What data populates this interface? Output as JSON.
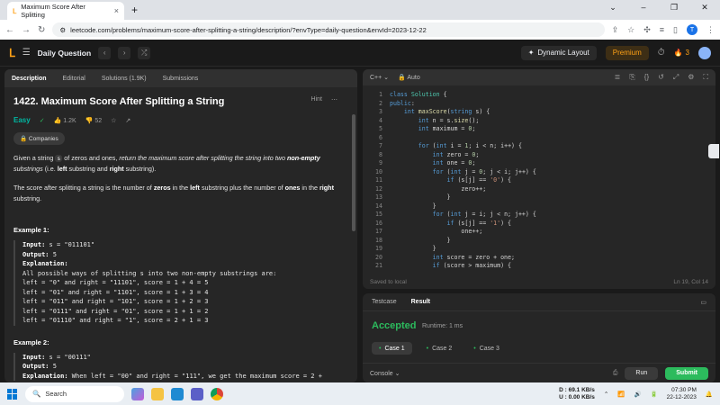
{
  "browser": {
    "tab_title": "Maximum Score After Splitting",
    "url": "leetcode.com/problems/maximum-score-after-splitting-a-string/description/?envType=daily-question&envId=2023-12-22"
  },
  "nav": {
    "title": "Daily Question",
    "dynamic_layout": "Dynamic Layout",
    "premium": "Premium",
    "streak": "3"
  },
  "left": {
    "tabs": [
      "Description",
      "Editorial",
      "Solutions (1.9K)",
      "Submissions"
    ],
    "problem_title": "1422. Maximum Score After Splitting a String",
    "hint": "Hint",
    "difficulty": "Easy",
    "likes": "1.2K",
    "dislikes": "52",
    "companies": "Companies",
    "desc1_a": "Given a string ",
    "desc1_s": "s",
    "desc1_b": " of zeros and ones, ",
    "desc1_c": "return the maximum score after splitting the string into two ",
    "desc1_d": "non-empty",
    "desc1_e": " substrings",
    "desc1_f": " (i.e. ",
    "desc1_g": "left",
    "desc1_h": " substring and ",
    "desc1_i": "right",
    "desc1_j": " substring).",
    "desc2_a": "The score after splitting a string is the number of ",
    "desc2_b": "zeros",
    "desc2_c": " in the ",
    "desc2_d": "left",
    "desc2_e": " substring plus the number of ",
    "desc2_f": "ones",
    "desc2_g": " in the ",
    "desc2_h": "right",
    "desc2_i": " substring.",
    "example1_title": "Example 1:",
    "example1_input_label": "Input:",
    "example1_input": " s = \"011101\"",
    "example1_output_label": "Output:",
    "example1_output": " 5",
    "example1_expl_label": "Explanation:",
    "example1_expl_lines": [
      "All possible ways of splitting s into two non-empty substrings are:",
      "left = \"0\" and right = \"11101\", score = 1 + 4 = 5",
      "left = \"01\" and right = \"1101\", score = 1 + 3 = 4",
      "left = \"011\" and right = \"101\", score = 1 + 2 = 3",
      "left = \"0111\" and right = \"01\", score = 1 + 1 = 2",
      "left = \"01110\" and right = \"1\", score = 2 + 1 = 3"
    ],
    "example2_title": "Example 2:",
    "example2_input_label": "Input:",
    "example2_input": " s = \"00111\"",
    "example2_output_label": "Output:",
    "example2_output": " 5",
    "example2_expl_label": "Explanation:",
    "example2_expl": " When left = \"00\" and right = \"111\", we get the maximum score = 2 +"
  },
  "editor": {
    "language": "C++",
    "mode": "Auto",
    "saved": "Saved to local",
    "position": "Ln 19, Col 14",
    "line_numbers": [
      "1",
      "2",
      "3",
      "4",
      "5",
      "6",
      "7",
      "8",
      "9",
      "10",
      "11",
      "12",
      "13",
      "14",
      "15",
      "16",
      "17",
      "18",
      "19",
      "20",
      "21"
    ]
  },
  "result": {
    "tabs": [
      "Testcase",
      "Result"
    ],
    "status": "Accepted",
    "runtime": "Runtime: 1 ms",
    "cases": [
      "Case 1",
      "Case 2",
      "Case 3"
    ],
    "console": "Console",
    "run": "Run",
    "submit": "Submit"
  },
  "taskbar": {
    "search": "Search",
    "net_down": "D : 69.1 KB/s",
    "net_up": "U : 0.00 KB/s",
    "time": "07:30 PM",
    "date": "22-12-2023"
  },
  "colors": {
    "accent": "#ffa116",
    "easy": "#00b8a3",
    "accepted": "#2cbb5d"
  }
}
